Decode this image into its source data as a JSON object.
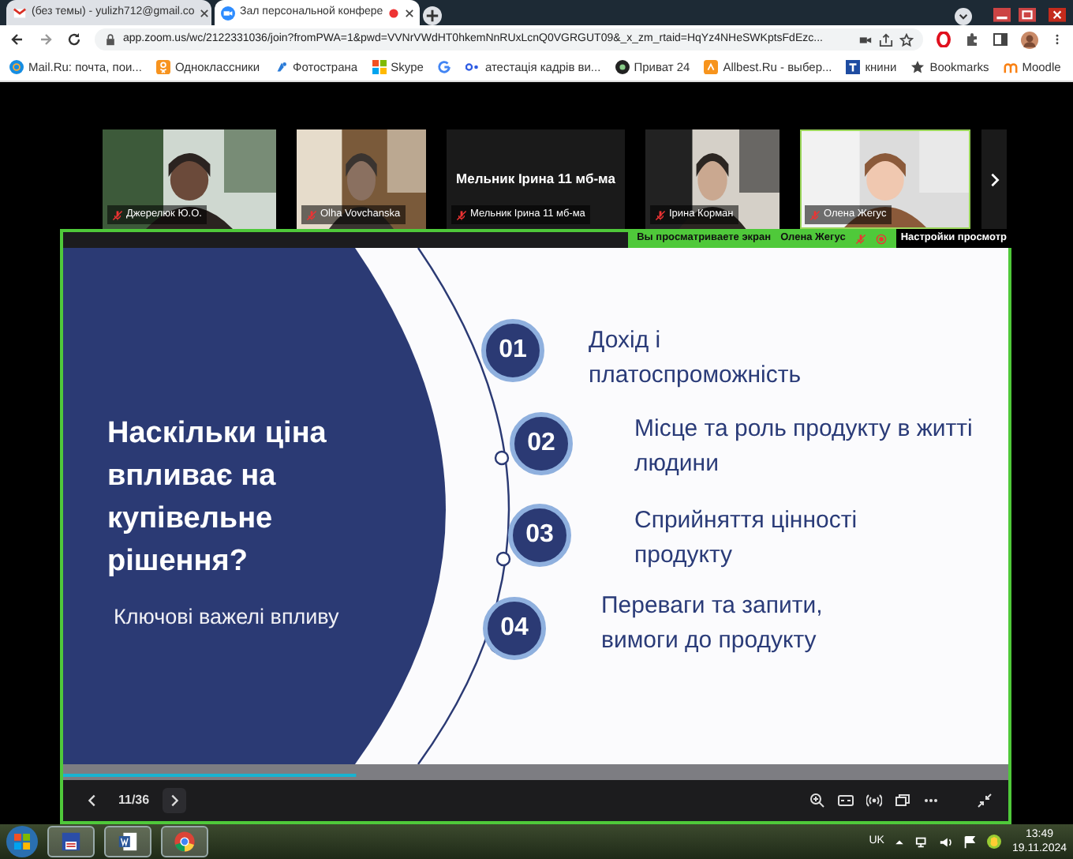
{
  "browser": {
    "tabs": [
      {
        "kind": "mail",
        "title": "(без темы) - yulizh712@gmail.co",
        "selected": false
      },
      {
        "kind": "zoom",
        "title": "Зал персональной конфере",
        "selected": true
      }
    ],
    "url": "app.zoom.us/wc/2122331036/join?fromPWA=1&pwd=VVNrVWdHT0hkemNnRUxLcnQ0VGRGUT09&_x_zm_rtaid=HqYz4NHeSWKptsFdEzc...",
    "bookmarks": [
      {
        "kind": "mailru",
        "label": "Mail.Ru: почта, пои..."
      },
      {
        "kind": "ok",
        "label": "Одноклассники"
      },
      {
        "kind": "fs",
        "label": "Фотострана"
      },
      {
        "kind": "skype",
        "label": "Skype"
      },
      {
        "kind": "google"
      },
      {
        "kind": "oo",
        "label": "атестація кадрів ви..."
      },
      {
        "kind": "p24",
        "label": "Приват 24"
      },
      {
        "kind": "allbest",
        "label": "Allbest.Ru - выбер..."
      },
      {
        "kind": "t",
        "label": "книни"
      },
      {
        "kind": "star",
        "label": "Bookmarks"
      },
      {
        "kind": "moodle",
        "label": "Moodle"
      }
    ]
  },
  "meeting": {
    "participants": [
      {
        "kind": "video",
        "name": "Джерелюк Ю.О.",
        "speaking": false
      },
      {
        "kind": "video",
        "name": "Olha Vovchanska",
        "speaking": false
      },
      {
        "kind": "name",
        "title": "Мельник Ірина 11 мб-ма",
        "name": "Мельник Ірина 11 мб-ма",
        "speaking": false
      },
      {
        "kind": "video",
        "name": "Ірина Корман",
        "speaking": false
      },
      {
        "kind": "video",
        "name": "Олена Жегус",
        "speaking": true
      }
    ],
    "banner": {
      "viewing": "Вы просматриваете экран",
      "presenter": "Олена Жегус",
      "settings": "Настройки просмотр"
    },
    "slide": {
      "title": "Наскільки ціна впливає на купівельне рішення?",
      "subtitle": "Ключові важелі впливу",
      "points": [
        {
          "number": "01",
          "text": "Дохід і платоспроможність"
        },
        {
          "number": "02",
          "text": "Місце та роль продукту в житті людини"
        },
        {
          "number": "03",
          "text": "Сприйняття цінності продукту"
        },
        {
          "number": "04",
          "text": "Переваги та запити, вимоги до продукту"
        }
      ],
      "progress": {
        "level": 0.31
      }
    },
    "controls": {
      "page": "11/36"
    }
  },
  "taskbar": {
    "lang": "UK",
    "time": "13:49",
    "date": "19.11.2024"
  }
}
